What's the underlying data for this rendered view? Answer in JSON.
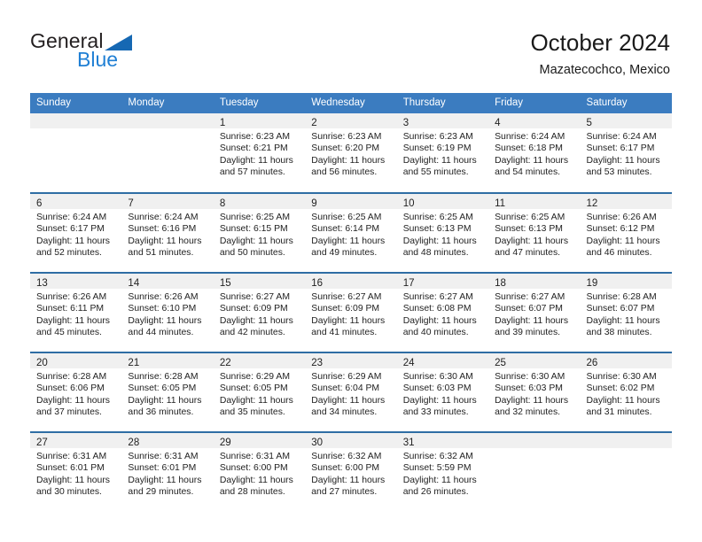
{
  "brand": {
    "name_top": "General",
    "name_bottom": "Blue",
    "triangle_icon": "triangle-icon",
    "color_dark": "#231f20",
    "color_blue": "#1f7fd4"
  },
  "header": {
    "title": "October 2024",
    "subtitle": "Mazatecochco, Mexico"
  },
  "theme": {
    "header_blue": "#3b7cc0",
    "row_rule_blue": "#2e6da4",
    "daynum_band": "#f0f0f0",
    "text": "#222222"
  },
  "weekday_headers": [
    "Sunday",
    "Monday",
    "Tuesday",
    "Wednesday",
    "Thursday",
    "Friday",
    "Saturday"
  ],
  "labels": {
    "sunrise_prefix": "Sunrise:",
    "sunset_prefix": "Sunset:",
    "daylight_prefix": "Daylight:"
  },
  "weeks": [
    [
      {
        "day": "",
        "lines": []
      },
      {
        "day": "",
        "lines": []
      },
      {
        "day": "1",
        "lines": [
          "Sunrise: 6:23 AM",
          "Sunset: 6:21 PM",
          "Daylight: 11 hours",
          "and 57 minutes."
        ]
      },
      {
        "day": "2",
        "lines": [
          "Sunrise: 6:23 AM",
          "Sunset: 6:20 PM",
          "Daylight: 11 hours",
          "and 56 minutes."
        ]
      },
      {
        "day": "3",
        "lines": [
          "Sunrise: 6:23 AM",
          "Sunset: 6:19 PM",
          "Daylight: 11 hours",
          "and 55 minutes."
        ]
      },
      {
        "day": "4",
        "lines": [
          "Sunrise: 6:24 AM",
          "Sunset: 6:18 PM",
          "Daylight: 11 hours",
          "and 54 minutes."
        ]
      },
      {
        "day": "5",
        "lines": [
          "Sunrise: 6:24 AM",
          "Sunset: 6:17 PM",
          "Daylight: 11 hours",
          "and 53 minutes."
        ]
      }
    ],
    [
      {
        "day": "6",
        "lines": [
          "Sunrise: 6:24 AM",
          "Sunset: 6:17 PM",
          "Daylight: 11 hours",
          "and 52 minutes."
        ]
      },
      {
        "day": "7",
        "lines": [
          "Sunrise: 6:24 AM",
          "Sunset: 6:16 PM",
          "Daylight: 11 hours",
          "and 51 minutes."
        ]
      },
      {
        "day": "8",
        "lines": [
          "Sunrise: 6:25 AM",
          "Sunset: 6:15 PM",
          "Daylight: 11 hours",
          "and 50 minutes."
        ]
      },
      {
        "day": "9",
        "lines": [
          "Sunrise: 6:25 AM",
          "Sunset: 6:14 PM",
          "Daylight: 11 hours",
          "and 49 minutes."
        ]
      },
      {
        "day": "10",
        "lines": [
          "Sunrise: 6:25 AM",
          "Sunset: 6:13 PM",
          "Daylight: 11 hours",
          "and 48 minutes."
        ]
      },
      {
        "day": "11",
        "lines": [
          "Sunrise: 6:25 AM",
          "Sunset: 6:13 PM",
          "Daylight: 11 hours",
          "and 47 minutes."
        ]
      },
      {
        "day": "12",
        "lines": [
          "Sunrise: 6:26 AM",
          "Sunset: 6:12 PM",
          "Daylight: 11 hours",
          "and 46 minutes."
        ]
      }
    ],
    [
      {
        "day": "13",
        "lines": [
          "Sunrise: 6:26 AM",
          "Sunset: 6:11 PM",
          "Daylight: 11 hours",
          "and 45 minutes."
        ]
      },
      {
        "day": "14",
        "lines": [
          "Sunrise: 6:26 AM",
          "Sunset: 6:10 PM",
          "Daylight: 11 hours",
          "and 44 minutes."
        ]
      },
      {
        "day": "15",
        "lines": [
          "Sunrise: 6:27 AM",
          "Sunset: 6:09 PM",
          "Daylight: 11 hours",
          "and 42 minutes."
        ]
      },
      {
        "day": "16",
        "lines": [
          "Sunrise: 6:27 AM",
          "Sunset: 6:09 PM",
          "Daylight: 11 hours",
          "and 41 minutes."
        ]
      },
      {
        "day": "17",
        "lines": [
          "Sunrise: 6:27 AM",
          "Sunset: 6:08 PM",
          "Daylight: 11 hours",
          "and 40 minutes."
        ]
      },
      {
        "day": "18",
        "lines": [
          "Sunrise: 6:27 AM",
          "Sunset: 6:07 PM",
          "Daylight: 11 hours",
          "and 39 minutes."
        ]
      },
      {
        "day": "19",
        "lines": [
          "Sunrise: 6:28 AM",
          "Sunset: 6:07 PM",
          "Daylight: 11 hours",
          "and 38 minutes."
        ]
      }
    ],
    [
      {
        "day": "20",
        "lines": [
          "Sunrise: 6:28 AM",
          "Sunset: 6:06 PM",
          "Daylight: 11 hours",
          "and 37 minutes."
        ]
      },
      {
        "day": "21",
        "lines": [
          "Sunrise: 6:28 AM",
          "Sunset: 6:05 PM",
          "Daylight: 11 hours",
          "and 36 minutes."
        ]
      },
      {
        "day": "22",
        "lines": [
          "Sunrise: 6:29 AM",
          "Sunset: 6:05 PM",
          "Daylight: 11 hours",
          "and 35 minutes."
        ]
      },
      {
        "day": "23",
        "lines": [
          "Sunrise: 6:29 AM",
          "Sunset: 6:04 PM",
          "Daylight: 11 hours",
          "and 34 minutes."
        ]
      },
      {
        "day": "24",
        "lines": [
          "Sunrise: 6:30 AM",
          "Sunset: 6:03 PM",
          "Daylight: 11 hours",
          "and 33 minutes."
        ]
      },
      {
        "day": "25",
        "lines": [
          "Sunrise: 6:30 AM",
          "Sunset: 6:03 PM",
          "Daylight: 11 hours",
          "and 32 minutes."
        ]
      },
      {
        "day": "26",
        "lines": [
          "Sunrise: 6:30 AM",
          "Sunset: 6:02 PM",
          "Daylight: 11 hours",
          "and 31 minutes."
        ]
      }
    ],
    [
      {
        "day": "27",
        "lines": [
          "Sunrise: 6:31 AM",
          "Sunset: 6:01 PM",
          "Daylight: 11 hours",
          "and 30 minutes."
        ]
      },
      {
        "day": "28",
        "lines": [
          "Sunrise: 6:31 AM",
          "Sunset: 6:01 PM",
          "Daylight: 11 hours",
          "and 29 minutes."
        ]
      },
      {
        "day": "29",
        "lines": [
          "Sunrise: 6:31 AM",
          "Sunset: 6:00 PM",
          "Daylight: 11 hours",
          "and 28 minutes."
        ]
      },
      {
        "day": "30",
        "lines": [
          "Sunrise: 6:32 AM",
          "Sunset: 6:00 PM",
          "Daylight: 11 hours",
          "and 27 minutes."
        ]
      },
      {
        "day": "31",
        "lines": [
          "Sunrise: 6:32 AM",
          "Sunset: 5:59 PM",
          "Daylight: 11 hours",
          "and 26 minutes."
        ]
      },
      {
        "day": "",
        "lines": []
      },
      {
        "day": "",
        "lines": []
      }
    ]
  ]
}
